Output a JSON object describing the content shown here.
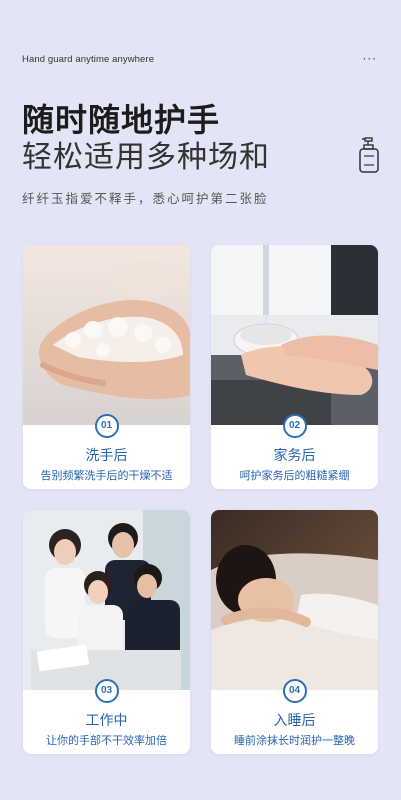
{
  "header": {
    "tagline": "Hand guard anytime anywhere",
    "more": "···",
    "title_line1": "随时随地护手",
    "title_line2": "轻松适用多种场和",
    "subtitle": "纤纤玉指爱不释手，悉心呵护第二张脸"
  },
  "cards": [
    {
      "num": "01",
      "title": "洗手后",
      "desc": "告别频繁洗手后的干燥不适"
    },
    {
      "num": "02",
      "title": "家务后",
      "desc": "呵护家务后的粗糙紧绷"
    },
    {
      "num": "03",
      "title": "工作中",
      "desc": "让你的手部不干效率加倍"
    },
    {
      "num": "04",
      "title": "入睡后",
      "desc": "睡前涂抹长时润护一整晚"
    }
  ],
  "colors": {
    "background": "#e3e5f6",
    "accent": "#2a64b0",
    "card": "#ffffff"
  }
}
